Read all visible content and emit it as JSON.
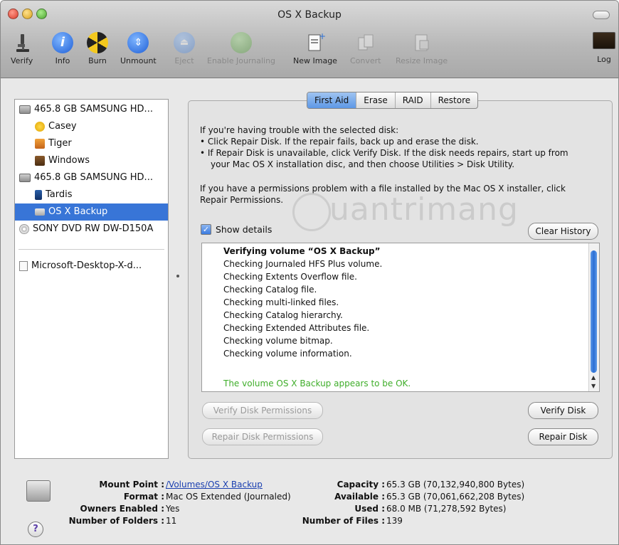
{
  "window": {
    "title": "OS X Backup"
  },
  "toolbar": {
    "items": [
      {
        "label": "Verify",
        "icon": "microscope-icon",
        "enabled": true
      },
      {
        "label": "Info",
        "icon": "info-icon",
        "enabled": true
      },
      {
        "label": "Burn",
        "icon": "burn-icon",
        "enabled": true
      },
      {
        "label": "Unmount",
        "icon": "unmount-icon",
        "enabled": true
      },
      {
        "label": "Eject",
        "icon": "eject-icon",
        "enabled": false
      },
      {
        "label": "Enable Journaling",
        "icon": "journaling-icon",
        "enabled": false
      },
      {
        "label": "New Image",
        "icon": "new-image-icon",
        "enabled": true
      },
      {
        "label": "Convert",
        "icon": "convert-icon",
        "enabled": false
      },
      {
        "label": "Resize Image",
        "icon": "resize-image-icon",
        "enabled": false
      },
      {
        "label": "Log",
        "icon": "log-icon",
        "enabled": true
      }
    ]
  },
  "sidebar": {
    "items": [
      {
        "label": "465.8 GB SAMSUNG HD...",
        "icon": "hard-disk-icon"
      },
      {
        "label": "Casey",
        "icon": "volume-icon"
      },
      {
        "label": "Tiger",
        "icon": "volume-icon"
      },
      {
        "label": "Windows",
        "icon": "volume-icon"
      },
      {
        "label": "465.8 GB SAMSUNG HD...",
        "icon": "hard-disk-icon"
      },
      {
        "label": "Tardis",
        "icon": "volume-icon"
      },
      {
        "label": "OS X Backup",
        "icon": "volume-icon",
        "selected": true
      },
      {
        "label": "SONY DVD RW DW-D150A",
        "icon": "optical-drive-icon"
      },
      {
        "label": "Microsoft-Desktop-X-d...",
        "icon": "disk-image-icon"
      }
    ]
  },
  "tabs": [
    {
      "label": "First Aid",
      "active": true
    },
    {
      "label": "Erase"
    },
    {
      "label": "RAID"
    },
    {
      "label": "Restore"
    }
  ],
  "first_aid": {
    "intro": "If you're having trouble with the selected disk:",
    "bullet1": "• Click Repair Disk. If the repair fails, back up and erase the disk.",
    "bullet2a": "• If Repair Disk is unavailable, click Verify Disk. If the disk needs repairs, start up from",
    "bullet2b": "your Mac OS X installation disc, and then choose Utilities > Disk Utility.",
    "perm1": "If you have a permissions problem with a file installed by the Mac OS X installer, click",
    "perm2": "Repair Permissions.",
    "show_details": "Show details",
    "clear_history": "Clear History",
    "log_heading": "Verifying volume “OS X Backup”",
    "log_lines": [
      "Checking Journaled HFS Plus volume.",
      "Checking Extents Overflow file.",
      "Checking Catalog file.",
      "Checking multi-linked files.",
      "Checking Catalog hierarchy.",
      "Checking Extended Attributes file.",
      "Checking volume bitmap.",
      "Checking volume information."
    ],
    "log_result": "The volume OS X Backup appears to be OK.",
    "verify_permissions": "Verify Disk Permissions",
    "repair_permissions": "Repair Disk Permissions",
    "verify_disk": "Verify Disk",
    "repair_disk": "Repair Disk"
  },
  "info": {
    "mount_point_label": "Mount Point :",
    "mount_point": "/Volumes/OS X Backup",
    "format_label": "Format :",
    "format": "Mac OS Extended (Journaled)",
    "owners_label": "Owners Enabled :",
    "owners": "Yes",
    "folders_label": "Number of Folders :",
    "folders": "11",
    "capacity_label": "Capacity :",
    "capacity": "65.3 GB (70,132,940,800 Bytes)",
    "available_label": "Available :",
    "available": "65.3 GB (70,061,662,208 Bytes)",
    "used_label": "Used :",
    "used": "68.0 MB (71,278,592 Bytes)",
    "files_label": "Number of Files :",
    "files": "139"
  },
  "watermark": "uantrimang",
  "colors": {
    "selection": "#3875d7",
    "ok_text": "#3fae2a",
    "link": "#1a3fb0"
  }
}
